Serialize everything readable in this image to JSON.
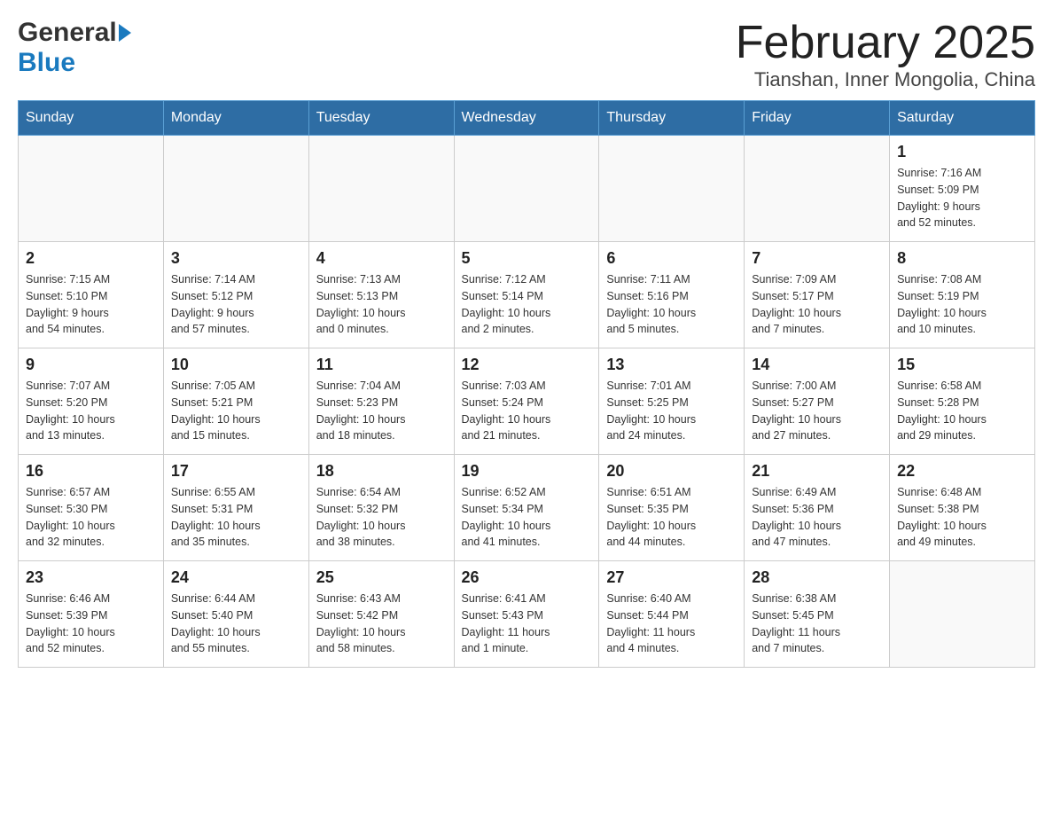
{
  "header": {
    "logo_general": "General",
    "logo_blue": "Blue",
    "title": "February 2025",
    "subtitle": "Tianshan, Inner Mongolia, China"
  },
  "days_of_week": [
    "Sunday",
    "Monday",
    "Tuesday",
    "Wednesday",
    "Thursday",
    "Friday",
    "Saturday"
  ],
  "weeks": [
    {
      "days": [
        {
          "date": "",
          "info": ""
        },
        {
          "date": "",
          "info": ""
        },
        {
          "date": "",
          "info": ""
        },
        {
          "date": "",
          "info": ""
        },
        {
          "date": "",
          "info": ""
        },
        {
          "date": "",
          "info": ""
        },
        {
          "date": "1",
          "info": "Sunrise: 7:16 AM\nSunset: 5:09 PM\nDaylight: 9 hours\nand 52 minutes."
        }
      ]
    },
    {
      "days": [
        {
          "date": "2",
          "info": "Sunrise: 7:15 AM\nSunset: 5:10 PM\nDaylight: 9 hours\nand 54 minutes."
        },
        {
          "date": "3",
          "info": "Sunrise: 7:14 AM\nSunset: 5:12 PM\nDaylight: 9 hours\nand 57 minutes."
        },
        {
          "date": "4",
          "info": "Sunrise: 7:13 AM\nSunset: 5:13 PM\nDaylight: 10 hours\nand 0 minutes."
        },
        {
          "date": "5",
          "info": "Sunrise: 7:12 AM\nSunset: 5:14 PM\nDaylight: 10 hours\nand 2 minutes."
        },
        {
          "date": "6",
          "info": "Sunrise: 7:11 AM\nSunset: 5:16 PM\nDaylight: 10 hours\nand 5 minutes."
        },
        {
          "date": "7",
          "info": "Sunrise: 7:09 AM\nSunset: 5:17 PM\nDaylight: 10 hours\nand 7 minutes."
        },
        {
          "date": "8",
          "info": "Sunrise: 7:08 AM\nSunset: 5:19 PM\nDaylight: 10 hours\nand 10 minutes."
        }
      ]
    },
    {
      "days": [
        {
          "date": "9",
          "info": "Sunrise: 7:07 AM\nSunset: 5:20 PM\nDaylight: 10 hours\nand 13 minutes."
        },
        {
          "date": "10",
          "info": "Sunrise: 7:05 AM\nSunset: 5:21 PM\nDaylight: 10 hours\nand 15 minutes."
        },
        {
          "date": "11",
          "info": "Sunrise: 7:04 AM\nSunset: 5:23 PM\nDaylight: 10 hours\nand 18 minutes."
        },
        {
          "date": "12",
          "info": "Sunrise: 7:03 AM\nSunset: 5:24 PM\nDaylight: 10 hours\nand 21 minutes."
        },
        {
          "date": "13",
          "info": "Sunrise: 7:01 AM\nSunset: 5:25 PM\nDaylight: 10 hours\nand 24 minutes."
        },
        {
          "date": "14",
          "info": "Sunrise: 7:00 AM\nSunset: 5:27 PM\nDaylight: 10 hours\nand 27 minutes."
        },
        {
          "date": "15",
          "info": "Sunrise: 6:58 AM\nSunset: 5:28 PM\nDaylight: 10 hours\nand 29 minutes."
        }
      ]
    },
    {
      "days": [
        {
          "date": "16",
          "info": "Sunrise: 6:57 AM\nSunset: 5:30 PM\nDaylight: 10 hours\nand 32 minutes."
        },
        {
          "date": "17",
          "info": "Sunrise: 6:55 AM\nSunset: 5:31 PM\nDaylight: 10 hours\nand 35 minutes."
        },
        {
          "date": "18",
          "info": "Sunrise: 6:54 AM\nSunset: 5:32 PM\nDaylight: 10 hours\nand 38 minutes."
        },
        {
          "date": "19",
          "info": "Sunrise: 6:52 AM\nSunset: 5:34 PM\nDaylight: 10 hours\nand 41 minutes."
        },
        {
          "date": "20",
          "info": "Sunrise: 6:51 AM\nSunset: 5:35 PM\nDaylight: 10 hours\nand 44 minutes."
        },
        {
          "date": "21",
          "info": "Sunrise: 6:49 AM\nSunset: 5:36 PM\nDaylight: 10 hours\nand 47 minutes."
        },
        {
          "date": "22",
          "info": "Sunrise: 6:48 AM\nSunset: 5:38 PM\nDaylight: 10 hours\nand 49 minutes."
        }
      ]
    },
    {
      "days": [
        {
          "date": "23",
          "info": "Sunrise: 6:46 AM\nSunset: 5:39 PM\nDaylight: 10 hours\nand 52 minutes."
        },
        {
          "date": "24",
          "info": "Sunrise: 6:44 AM\nSunset: 5:40 PM\nDaylight: 10 hours\nand 55 minutes."
        },
        {
          "date": "25",
          "info": "Sunrise: 6:43 AM\nSunset: 5:42 PM\nDaylight: 10 hours\nand 58 minutes."
        },
        {
          "date": "26",
          "info": "Sunrise: 6:41 AM\nSunset: 5:43 PM\nDaylight: 11 hours\nand 1 minute."
        },
        {
          "date": "27",
          "info": "Sunrise: 6:40 AM\nSunset: 5:44 PM\nDaylight: 11 hours\nand 4 minutes."
        },
        {
          "date": "28",
          "info": "Sunrise: 6:38 AM\nSunset: 5:45 PM\nDaylight: 11 hours\nand 7 minutes."
        },
        {
          "date": "",
          "info": ""
        }
      ]
    }
  ]
}
